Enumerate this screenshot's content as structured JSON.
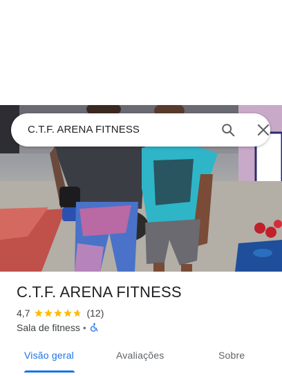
{
  "search": {
    "query": "C.T.F. ARENA FITNESS"
  },
  "place": {
    "name": "C.T.F. ARENA FITNESS",
    "rating": "4,7",
    "rating_stars": 4.7,
    "review_count": "(12)",
    "category": "Sala de fitness",
    "separator": "•"
  },
  "tabs": [
    {
      "label": "Visão geral",
      "active": true
    },
    {
      "label": "Avaliações",
      "active": false
    },
    {
      "label": "Sobre",
      "active": false
    }
  ],
  "colors": {
    "accent": "#1a73e8",
    "star": "#fbbc04"
  },
  "icons": {
    "search": "search-icon",
    "close": "close-icon",
    "accessibility": "wheelchair-icon"
  }
}
